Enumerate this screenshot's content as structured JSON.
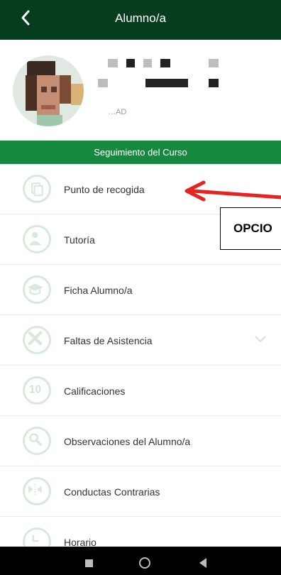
{
  "header": {
    "title": "Alumno/a",
    "back_icon": "chevron-left-icon"
  },
  "profile": {
    "subtext": "…AD"
  },
  "section": {
    "title": "Seguimiento del Curso"
  },
  "menu": [
    {
      "label": "Punto de recogida",
      "icon": "document-icon"
    },
    {
      "label": "Tutoría",
      "icon": "person-icon"
    },
    {
      "label": "Ficha Alumno/a",
      "icon": "graduation-cap-icon"
    },
    {
      "label": "Faltas de Asistencia",
      "icon": "x-icon",
      "expandable": true
    },
    {
      "label": "Calificaciones",
      "icon": "ten-icon",
      "icon_text": "10"
    },
    {
      "label": "Observaciones del Alumno/a",
      "icon": "magnifier-icon"
    },
    {
      "label": "Conductas Contrarias",
      "icon": "split-icon"
    },
    {
      "label": "Horario",
      "icon": "clock-icon"
    }
  ],
  "annotation": {
    "callout_text": "OPCIO",
    "arrow_color": "#e52420"
  },
  "colors": {
    "appbar": "#063d1e",
    "section": "#16893f",
    "icon": "#d6eadb"
  }
}
